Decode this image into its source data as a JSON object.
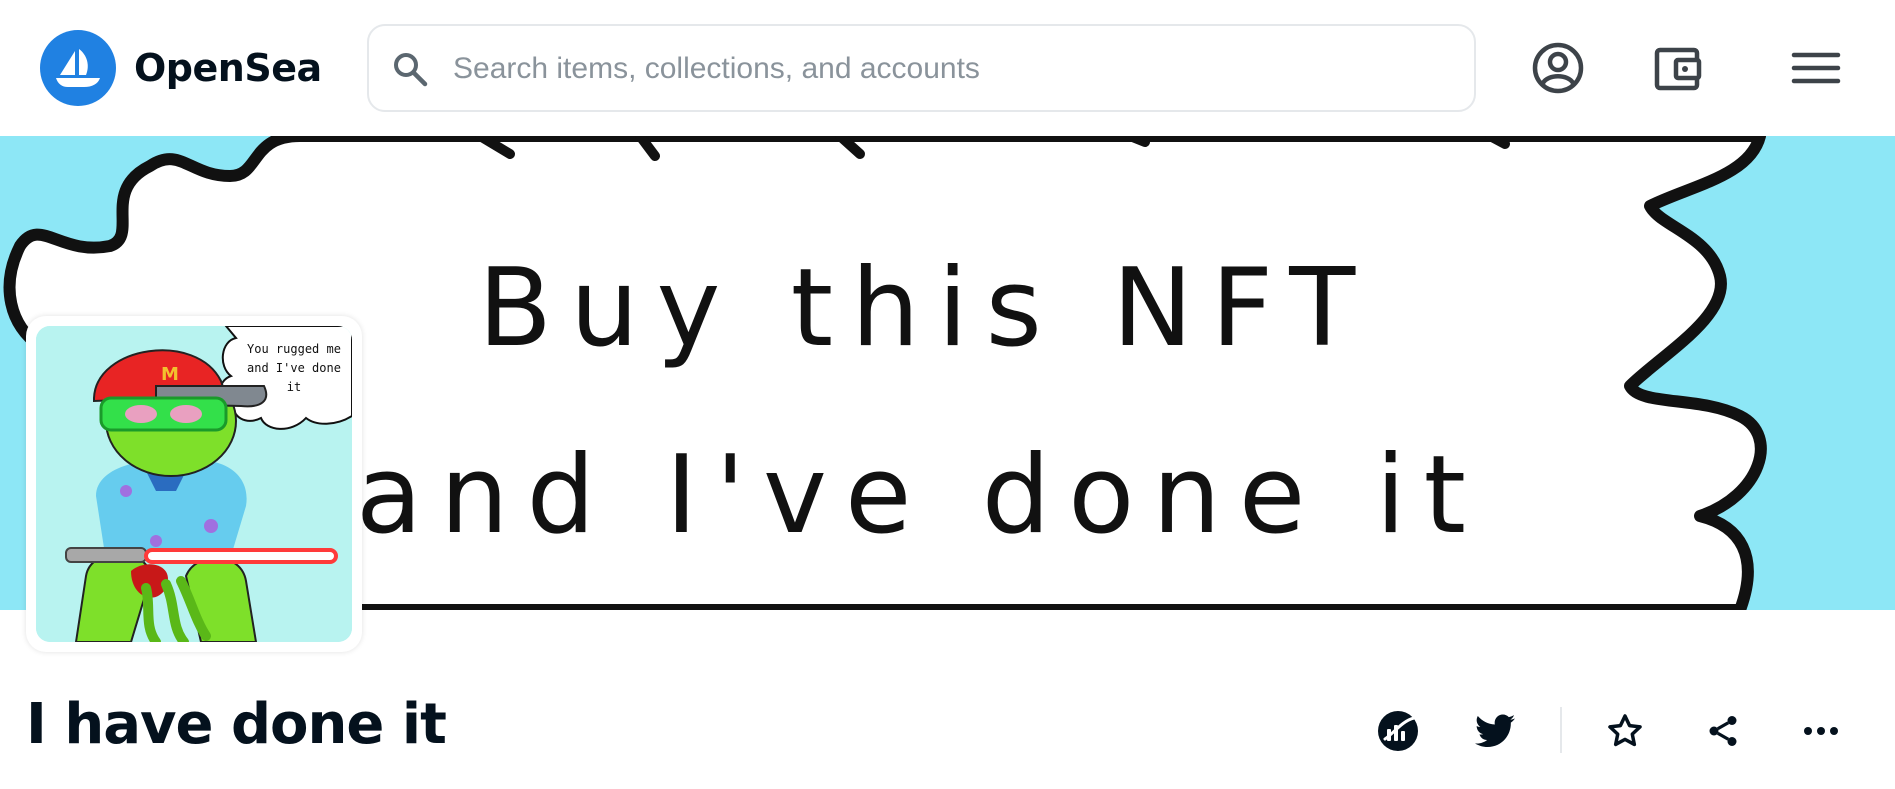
{
  "header": {
    "brand": "OpenSea",
    "search_placeholder": "Search items, collections, and accounts",
    "icons": [
      "boat-logo-icon",
      "search-icon",
      "profile-icon",
      "wallet-icon",
      "menu-icon"
    ]
  },
  "banner": {
    "line1": "Buy this NFT",
    "line2": "and I've done it",
    "background_color": "#8de7f6"
  },
  "avatar": {
    "bubble_line1": "You rugged me",
    "bubble_line2": "and I've done",
    "bubble_line3": "it",
    "cap_letter": "M"
  },
  "collection": {
    "title": "I have done it",
    "actions": [
      "activity-icon",
      "twitter-icon",
      "star-icon",
      "share-icon",
      "more-icon"
    ]
  },
  "colors": {
    "brand_blue": "#2081e2",
    "text": "#04111d",
    "muted": "#8a939b",
    "border": "#e5e8eb"
  }
}
